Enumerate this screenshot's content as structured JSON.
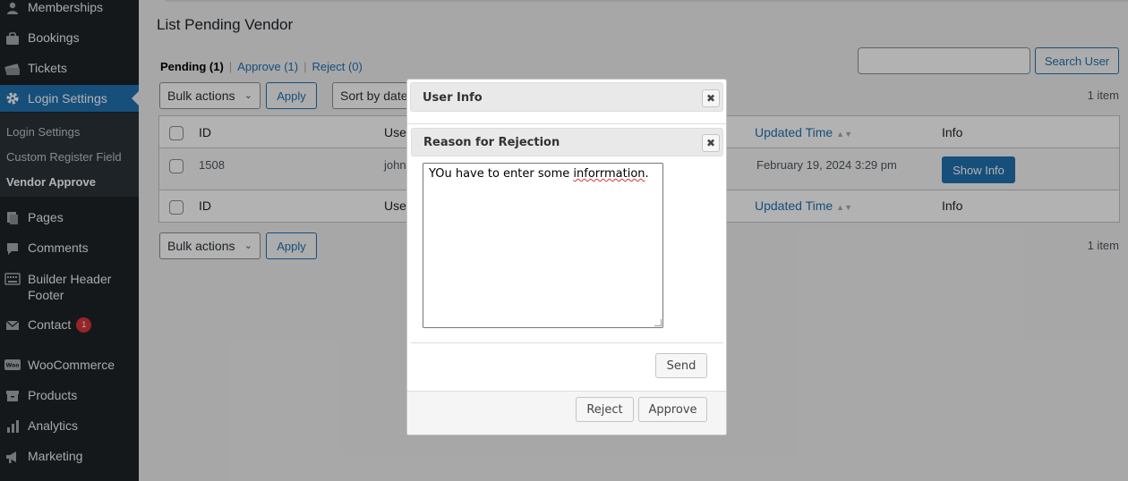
{
  "sidebar": {
    "items": [
      {
        "label": "Memberships",
        "icon": "person-icon"
      },
      {
        "label": "Bookings",
        "icon": "briefcase-icon"
      },
      {
        "label": "Tickets",
        "icon": "tickets-icon"
      },
      {
        "label": "Login Settings",
        "icon": "gear-icon"
      },
      {
        "label": "Pages",
        "icon": "pages-icon"
      },
      {
        "label": "Comments",
        "icon": "comment-icon"
      },
      {
        "label": "Builder Header Footer",
        "icon": "keyboard-icon"
      },
      {
        "label": "Contact",
        "icon": "mail-icon",
        "badge": "1"
      },
      {
        "label": "WooCommerce",
        "icon": "woo-icon"
      },
      {
        "label": "Products",
        "icon": "archive-icon"
      },
      {
        "label": "Analytics",
        "icon": "bar-chart-icon"
      },
      {
        "label": "Marketing",
        "icon": "megaphone-icon"
      }
    ],
    "submenu": [
      "Login Settings",
      "Custom Register Field",
      "Vendor Approve"
    ]
  },
  "main": {
    "title": "List Pending Vendor",
    "filters": {
      "pending": "Pending (1)",
      "approve": "Approve (1)",
      "reject": "Reject (0)",
      "separator": "|"
    },
    "search_button": "Search User",
    "bulk_actions": "Bulk actions",
    "apply": "Apply",
    "sort_by": "Sort by date",
    "items_count": "1 item",
    "table": {
      "columns": [
        "ID",
        "User",
        "Updated Time",
        "Info"
      ],
      "rows": [
        {
          "id": "1508",
          "user": "john",
          "updated": "February 19, 2024 3:29 pm",
          "action": "Show Info"
        }
      ]
    }
  },
  "dialog": {
    "title": "User Info",
    "inner_title": "Reason for Rejection",
    "reason_before": "YOu have to enter some ",
    "reason_misspelled": "inforrmation",
    "reason_after": ".",
    "send": "Send",
    "reject": "Reject",
    "approve": "Approve",
    "close_symbol": "✖"
  },
  "colors": {
    "sidebar_bg": "#1d2327",
    "accent": "#2271b1",
    "badge": "#d63638"
  }
}
